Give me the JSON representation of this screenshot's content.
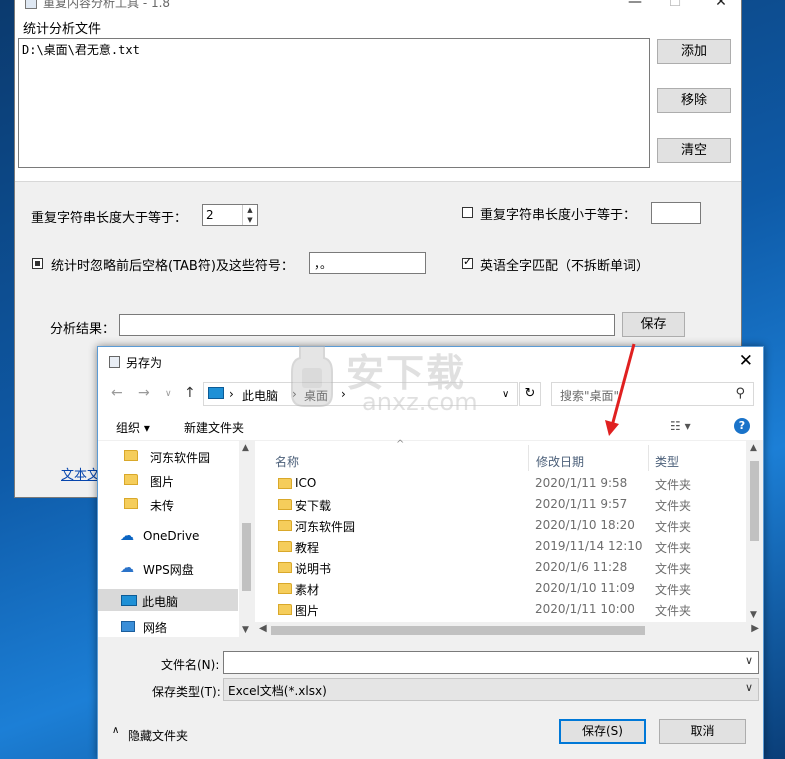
{
  "app": {
    "title": "重复内容分析工具 - 1.8",
    "window_controls": {
      "minimize": "—",
      "maximize": "☐",
      "close": "✕"
    },
    "file_section_label": "统计分析文件",
    "files": [
      "D:\\桌面\\君无意.txt"
    ],
    "buttons": {
      "add": "添加",
      "remove": "移除",
      "clear": "清空"
    },
    "min_length_label": "重复字符串长度大于等于：",
    "min_length_value": "2",
    "max_length_label": "重复字符串长度小于等于：",
    "max_length_checked": false,
    "max_length_value": "",
    "ignore_label": "统计时忽略前后空格(TAB符)及这些符号：",
    "ignore_checked": true,
    "ignore_symbols": "，。",
    "english_match_label": "英语全字匹配（不拆断单词）",
    "english_match_checked": true,
    "result_label": "分析结果：",
    "result_value": "",
    "save_button": "保存",
    "link_text": "文本文"
  },
  "dialog": {
    "title": "另存为",
    "close": "✕",
    "breadcrumb": [
      "此电脑",
      "桌面"
    ],
    "search_placeholder": "搜索\"桌面\"",
    "toolbar": {
      "organize": "组织 ▾",
      "new_folder": "新建文件夹",
      "help": "?"
    },
    "nav_items": [
      {
        "label": "河东软件园",
        "icon": "folder-icon"
      },
      {
        "label": "图片",
        "icon": "folder-icon"
      },
      {
        "label": "未传",
        "icon": "folder-icon"
      },
      {
        "label": "OneDrive",
        "icon": "cloud-icon"
      },
      {
        "label": "WPS网盘",
        "icon": "cloud-outline-icon"
      },
      {
        "label": "此电脑",
        "icon": "computer-icon",
        "selected": true
      },
      {
        "label": "网络",
        "icon": "network-icon"
      }
    ],
    "columns": {
      "name": "名称",
      "date": "修改日期",
      "type": "类型"
    },
    "files": [
      {
        "name": "ICO",
        "date": "2020/1/11 9:58",
        "type": "文件夹"
      },
      {
        "name": "安下载",
        "date": "2020/1/11 9:57",
        "type": "文件夹"
      },
      {
        "name": "河东软件园",
        "date": "2020/1/10 18:20",
        "type": "文件夹"
      },
      {
        "name": "教程",
        "date": "2019/11/14 12:10",
        "type": "文件夹"
      },
      {
        "name": "说明书",
        "date": "2020/1/6 11:28",
        "type": "文件夹"
      },
      {
        "name": "素材",
        "date": "2020/1/10 11:09",
        "type": "文件夹"
      },
      {
        "name": "图片",
        "date": "2020/1/11 10:00",
        "type": "文件夹"
      }
    ],
    "filename_label": "文件名(N):",
    "filename_value": "",
    "filetype_label": "保存类型(T):",
    "filetype_value": "Excel文档(*.xlsx)",
    "hide_folders": "隐藏文件夹",
    "save_button": "保存(S)",
    "cancel_button": "取消"
  },
  "watermark": {
    "text_cn": "安下载",
    "text_en": "anxz.com"
  },
  "colors": {
    "accent": "#0078d7",
    "folder": "#f5cd5b",
    "link": "#0645ad",
    "arrow": "#e02020"
  }
}
